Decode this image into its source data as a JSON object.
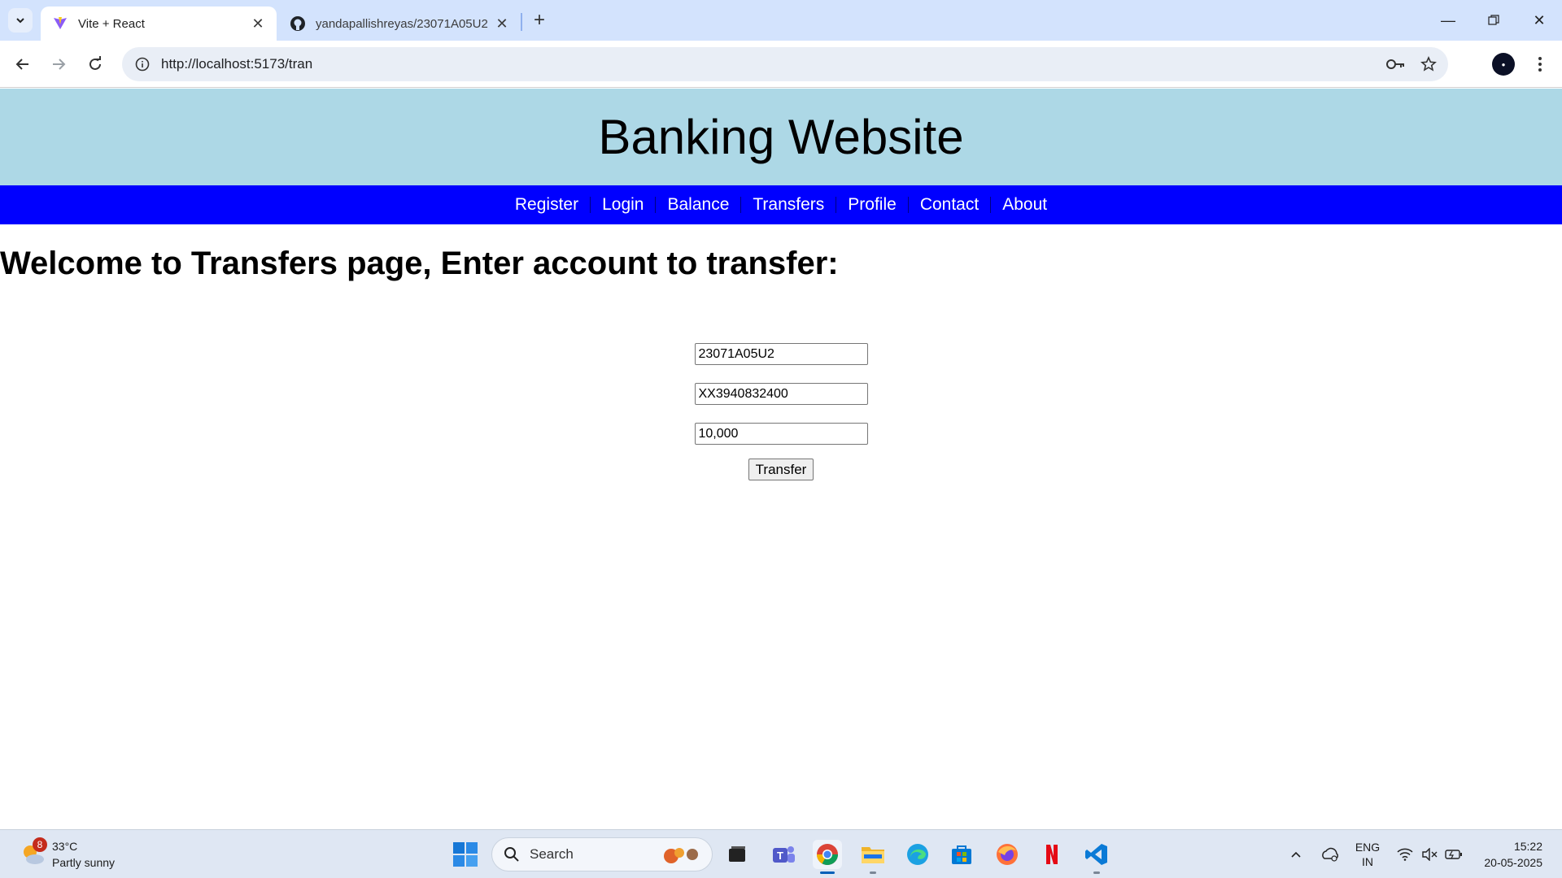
{
  "browser": {
    "tabs": [
      {
        "title": "Vite + React",
        "icon": "vite-icon",
        "active": true
      },
      {
        "title": "yandapallishreyas/23071A05U2",
        "icon": "github-icon",
        "active": false
      }
    ],
    "url": "http://localhost:5173/tran"
  },
  "site": {
    "title": "Banking Website",
    "nav": [
      "Register",
      "Login",
      "Balance",
      "Transfers",
      "Profile",
      "Contact",
      "About"
    ],
    "heading": "Welcome to Transfers page, Enter account to transfer:",
    "form": {
      "from_account": "23071A05U2",
      "to_account": "XX3940832400",
      "amount": "10,000",
      "submit_label": "Transfer"
    }
  },
  "taskbar": {
    "weather": {
      "temp": "33°C",
      "condition": "Partly sunny",
      "badge": "8"
    },
    "search_label": "Search",
    "tray": {
      "lang_line1": "ENG",
      "lang_line2": "IN"
    },
    "clock": {
      "time": "15:22",
      "date": "20-05-2025"
    }
  }
}
